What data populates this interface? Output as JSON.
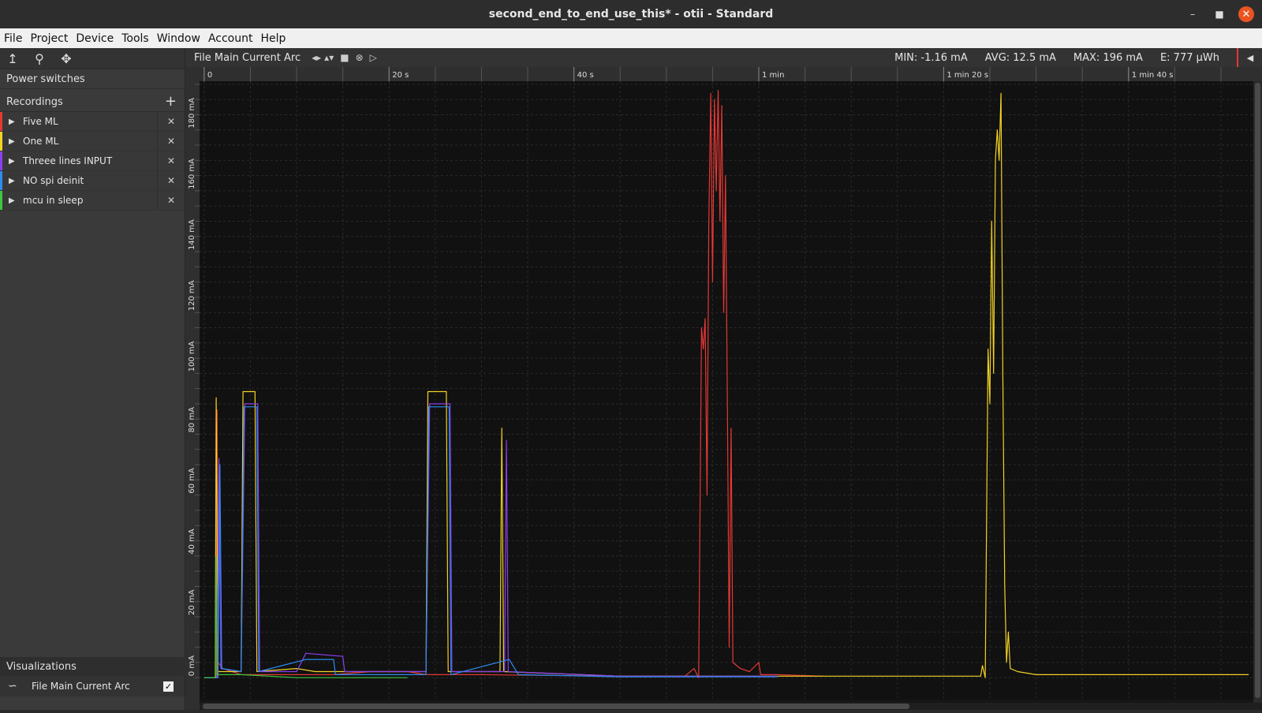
{
  "window": {
    "title": "second_end_to_end_use_this* - otii - Standard"
  },
  "menu": [
    "File",
    "Project",
    "Device",
    "Tools",
    "Window",
    "Account",
    "Help"
  ],
  "sidebar": {
    "power_switches": "Power switches",
    "recordings_title": "Recordings",
    "recordings": [
      {
        "name": "Five ML",
        "color": "#e53935"
      },
      {
        "name": "One ML",
        "color": "#f2d224"
      },
      {
        "name": "Threee lines INPUT",
        "color": "#8c3ff0"
      },
      {
        "name": "NO spi deinit",
        "color": "#2d8cf0"
      },
      {
        "name": "mcu in sleep",
        "color": "#3ec83e"
      }
    ],
    "visualizations_title": "Visualizations",
    "visualizations": [
      {
        "name": "File Main Current Arc",
        "checked": true
      }
    ]
  },
  "plot_toolbar": {
    "title": "File Main Current Arc",
    "min": "MIN: -1.16 mA",
    "avg": "AVG: 12.5 mA",
    "max": "MAX: 196 mA",
    "energy": "E: 777 µWh"
  },
  "chart_data": {
    "type": "line",
    "title": "",
    "xlabel": "",
    "ylabel": "",
    "x_ticks": [
      {
        "value": 0,
        "label": "0"
      },
      {
        "value": 20,
        "label": "20 s"
      },
      {
        "value": 40,
        "label": "40 s"
      },
      {
        "value": 60,
        "label": "1 min"
      },
      {
        "value": 80,
        "label": "1 min 20 s"
      },
      {
        "value": 100,
        "label": "1 min 40 s"
      }
    ],
    "y_ticks": [
      {
        "value": 0,
        "label": "0 mA"
      },
      {
        "value": 20,
        "label": "20 mA"
      },
      {
        "value": 40,
        "label": "40 mA"
      },
      {
        "value": 60,
        "label": "60 mA"
      },
      {
        "value": 80,
        "label": "80 mA"
      },
      {
        "value": 100,
        "label": "100 mA"
      },
      {
        "value": 120,
        "label": "120 mA"
      },
      {
        "value": 140,
        "label": "140 mA"
      },
      {
        "value": 160,
        "label": "160 mA"
      },
      {
        "value": 180,
        "label": "180 mA"
      }
    ],
    "xlim": [
      -0.5,
      113.5
    ],
    "ylim": [
      -1.5,
      196
    ],
    "grid": true,
    "series": [
      {
        "name": "Five ML",
        "color": "#e53935",
        "points": [
          [
            0,
            0
          ],
          [
            1.3,
            0
          ],
          [
            1.4,
            88
          ],
          [
            1.5,
            5
          ],
          [
            2,
            3
          ],
          [
            4,
            1
          ],
          [
            10,
            1
          ],
          [
            14,
            1
          ],
          [
            18,
            2
          ],
          [
            22,
            2
          ],
          [
            24,
            1
          ],
          [
            30,
            1
          ],
          [
            45,
            0.5
          ],
          [
            52,
            0.5
          ],
          [
            53,
            3
          ],
          [
            53.5,
            0
          ],
          [
            53.8,
            115
          ],
          [
            54,
            108
          ],
          [
            54.2,
            118
          ],
          [
            54.4,
            60
          ],
          [
            54.6,
            150
          ],
          [
            54.8,
            192
          ],
          [
            55,
            130
          ],
          [
            55.2,
            190
          ],
          [
            55.4,
            160
          ],
          [
            55.6,
            193
          ],
          [
            55.8,
            150
          ],
          [
            56,
            188
          ],
          [
            56.2,
            120
          ],
          [
            56.4,
            165
          ],
          [
            56.6,
            90
          ],
          [
            56.8,
            10
          ],
          [
            57,
            82
          ],
          [
            57.2,
            5
          ],
          [
            58,
            3
          ],
          [
            59,
            2
          ],
          [
            60,
            5
          ],
          [
            60.2,
            1
          ],
          [
            62,
            1
          ],
          [
            67,
            0.5
          ]
        ]
      },
      {
        "name": "One ML",
        "color": "#f2d224",
        "points": [
          [
            0,
            0
          ],
          [
            1.2,
            0
          ],
          [
            1.3,
            92
          ],
          [
            1.5,
            2
          ],
          [
            4,
            2
          ],
          [
            4.2,
            94
          ],
          [
            5.5,
            94
          ],
          [
            5.7,
            2
          ],
          [
            10,
            3
          ],
          [
            12,
            2
          ],
          [
            24,
            2
          ],
          [
            24.2,
            94
          ],
          [
            26.2,
            94
          ],
          [
            26.4,
            2
          ],
          [
            32,
            2
          ],
          [
            32.2,
            82
          ],
          [
            32.4,
            2
          ],
          [
            45,
            0.5
          ],
          [
            60,
            0.5
          ],
          [
            70,
            0.5
          ],
          [
            84,
            0.5
          ],
          [
            84.2,
            4
          ],
          [
            84.5,
            0
          ],
          [
            84.8,
            108
          ],
          [
            85,
            90
          ],
          [
            85.2,
            150
          ],
          [
            85.4,
            100
          ],
          [
            85.6,
            170
          ],
          [
            85.8,
            180
          ],
          [
            86,
            170
          ],
          [
            86.2,
            192
          ],
          [
            86.4,
            100
          ],
          [
            86.6,
            30
          ],
          [
            86.8,
            5
          ],
          [
            87,
            15
          ],
          [
            87.2,
            3
          ],
          [
            88,
            2
          ],
          [
            90,
            1
          ],
          [
            113,
            1
          ]
        ]
      },
      {
        "name": "Threee lines INPUT",
        "color": "#8c3ff0",
        "points": [
          [
            0,
            0
          ],
          [
            1.4,
            0
          ],
          [
            1.6,
            72
          ],
          [
            1.8,
            3
          ],
          [
            4,
            2
          ],
          [
            4.4,
            90
          ],
          [
            5.8,
            90
          ],
          [
            6,
            2
          ],
          [
            10,
            2
          ],
          [
            11,
            8
          ],
          [
            15,
            7
          ],
          [
            15.2,
            2
          ],
          [
            24,
            2
          ],
          [
            24.4,
            90
          ],
          [
            26.6,
            90
          ],
          [
            26.8,
            2
          ],
          [
            32.5,
            2
          ],
          [
            32.7,
            78
          ],
          [
            32.9,
            2
          ],
          [
            45,
            0.5
          ],
          [
            62,
            0.5
          ]
        ]
      },
      {
        "name": "NO spi deinit",
        "color": "#2d8cf0",
        "points": [
          [
            0,
            0
          ],
          [
            1.5,
            0
          ],
          [
            1.7,
            70
          ],
          [
            1.9,
            3
          ],
          [
            4,
            2
          ],
          [
            4.3,
            89
          ],
          [
            5.7,
            89
          ],
          [
            5.9,
            2
          ],
          [
            11,
            6
          ],
          [
            14,
            6
          ],
          [
            14.2,
            1
          ],
          [
            24,
            1
          ],
          [
            24.3,
            89
          ],
          [
            26.5,
            89
          ],
          [
            26.7,
            1
          ],
          [
            33,
            6
          ],
          [
            34,
            1
          ],
          [
            45,
            0.3
          ],
          [
            62,
            0.3
          ]
        ]
      },
      {
        "name": "mcu in sleep",
        "color": "#3ec83e",
        "points": [
          [
            0,
            0
          ],
          [
            1.2,
            0
          ],
          [
            1.3,
            40
          ],
          [
            1.4,
            1
          ],
          [
            4,
            1
          ],
          [
            10,
            0
          ],
          [
            20,
            0
          ],
          [
            22,
            0
          ]
        ]
      }
    ]
  }
}
